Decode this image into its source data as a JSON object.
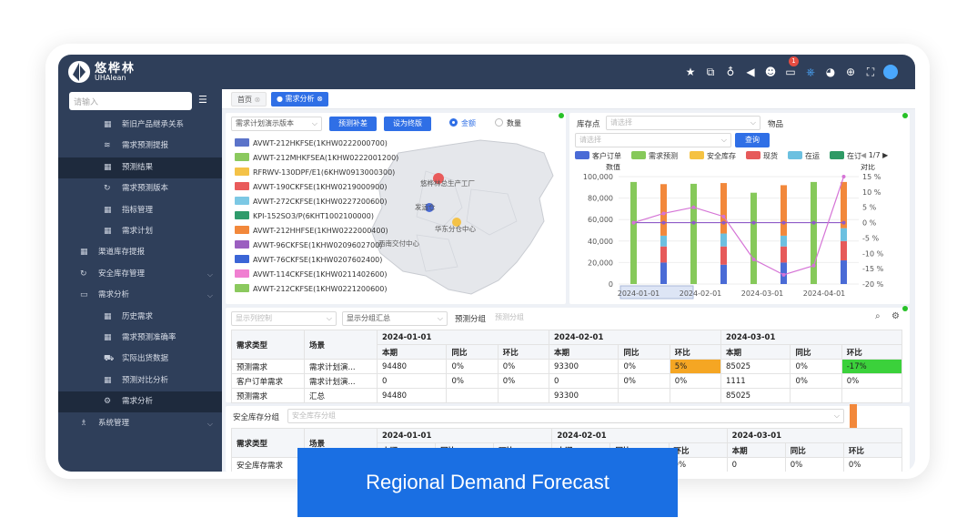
{
  "app": {
    "name_cn": "悠桦林",
    "name_en": "UHAlean",
    "notification_count": "1"
  },
  "topbar_icons": [
    "star-icon",
    "copy-icon",
    "user-settings-icon",
    "volume-icon",
    "face-icon",
    "message-icon",
    "robot-icon",
    "pie-icon",
    "globe-icon",
    "fullscreen-icon",
    "avatar"
  ],
  "sidebar": {
    "search_placeholder": "请输入",
    "items": [
      {
        "label": "新旧产品继承关系",
        "icon": "grid-icon",
        "level": 2
      },
      {
        "label": "需求预测提报",
        "icon": "layers-icon",
        "level": 2
      },
      {
        "label": "预测结果",
        "icon": "grid-icon",
        "level": 2,
        "active": true
      },
      {
        "label": "需求预测版本",
        "icon": "refresh-icon",
        "level": 2
      },
      {
        "label": "指标管理",
        "icon": "grid-icon",
        "level": 2
      },
      {
        "label": "需求计划",
        "icon": "grid-icon",
        "level": 2
      },
      {
        "label": "渠道库存提报",
        "icon": "grid-icon",
        "level": 1
      },
      {
        "label": "安全库存管理",
        "icon": "refresh-icon",
        "level": 1
      },
      {
        "label": "需求分析",
        "icon": "monitor-icon",
        "level": 1
      },
      {
        "label": "历史需求",
        "icon": "grid-icon",
        "level": 2
      },
      {
        "label": "需求预测准确率",
        "icon": "grid-icon",
        "level": 2
      },
      {
        "label": "实际出货数据",
        "icon": "truck-icon",
        "level": 2
      },
      {
        "label": "预测对比分析",
        "icon": "grid-icon",
        "level": 2
      },
      {
        "label": "需求分析",
        "icon": "gear-icon",
        "level": 2,
        "active": true
      },
      {
        "label": "系统管理",
        "icon": "users-icon",
        "level": 1
      }
    ]
  },
  "tabs": {
    "home": "首页",
    "active": "需求分析"
  },
  "toolbar": {
    "version_select": "需求计划演示版本",
    "btn_correct": "预测补差",
    "btn_baseline": "设为终版",
    "radio_amount": "金额",
    "radio_qty": "数量"
  },
  "map_legend": [
    {
      "label": "AVWT-212HKFSE(1KHW0222000700)",
      "color": "#5b73c9"
    },
    {
      "label": "AVWT-212MHKFSEA(1KHW0222001200)",
      "color": "#8bc95e"
    },
    {
      "label": "RFRWV-130DPF/E1(6KHW0913000300)",
      "color": "#f4c247"
    },
    {
      "label": "AVWT-190CKFSE(1KHW0219000900)",
      "color": "#e95b5b"
    },
    {
      "label": "AVWT-272CKFSE(1KHW0227200600)",
      "color": "#7cc8e4"
    },
    {
      "label": "KPI-152SO3/P(6KHT1002100000)",
      "color": "#2f9b6b"
    },
    {
      "label": "AVWT-212HHFSE(1KHW0222000400)",
      "color": "#f2883b"
    },
    {
      "label": "AVWT-96CKFSE(1KHW0209602700)",
      "color": "#9b5fc0"
    },
    {
      "label": "AVWT-76CKFSE(1KHW0207602400)",
      "color": "#3b65d6"
    },
    {
      "label": "AVWT-114CKFSE(1KHW0211402600)",
      "color": "#f07fd1"
    },
    {
      "label": "AVWT-212CKFSE(1KHW0221200600)",
      "color": "#8bc95e"
    }
  ],
  "map_labels": [
    "悠桦林总生产工厂",
    "发运仓",
    "华东分仓中心",
    "西南交付中心"
  ],
  "chart_filters": {
    "loc_label": "库存点",
    "loc_placeholder": "请选择",
    "item_label": "物品",
    "item_placeholder": "请选择",
    "query_button": "查询"
  },
  "chart_legend": [
    {
      "label": "客户订单",
      "color": "#4a6bd6"
    },
    {
      "label": "需求预测",
      "color": "#86c95a"
    },
    {
      "label": "安全库存",
      "color": "#f5c242"
    },
    {
      "label": "现货",
      "color": "#e65a5a"
    },
    {
      "label": "在运",
      "color": "#6cc0e0"
    },
    {
      "label": "在订",
      "color": "#2e9a65"
    }
  ],
  "legend_pager": "1/7",
  "chart_data": {
    "type": "bar",
    "y_left_label": "数值",
    "y_right_label": "对比",
    "y_left_ticks": [
      "100,000",
      "80,000",
      "60,000",
      "40,000",
      "20,000",
      "0"
    ],
    "y_right_ticks": [
      "15 %",
      "10 %",
      "5 %",
      "0 %",
      "-5 %",
      "-10 %",
      "-15 %",
      "-20 %"
    ],
    "x_ticks": [
      "2024-01-01",
      "2024-02-01",
      "2024-03-01",
      "2024-04-01"
    ],
    "ylim": [
      0,
      100000
    ],
    "y2lim": [
      -20,
      15
    ],
    "series_colors": [
      "#4a6bd6",
      "#86c95a",
      "#f5c242",
      "#e65a5a",
      "#6cc0e0",
      "#f2883b"
    ],
    "bars": [
      {
        "x": "2024-01-01",
        "series": "需求预测",
        "stack": [
          0,
          95000,
          0,
          0,
          0,
          0
        ]
      },
      {
        "x": "2024-01-01",
        "series": "stack",
        "stack": [
          20000,
          0,
          0,
          15000,
          10000,
          48000
        ]
      },
      {
        "x": "2024-02-01",
        "series": "需求预测",
        "stack": [
          0,
          93300,
          0,
          0,
          0,
          0
        ]
      },
      {
        "x": "2024-02-01",
        "series": "stack",
        "stack": [
          18000,
          0,
          0,
          17000,
          12000,
          47000
        ]
      },
      {
        "x": "2024-03-01",
        "series": "需求预测",
        "stack": [
          0,
          85000,
          0,
          0,
          0,
          0
        ]
      },
      {
        "x": "2024-03-01",
        "series": "stack",
        "stack": [
          20000,
          0,
          0,
          15000,
          10000,
          47000
        ]
      },
      {
        "x": "2024-04-01",
        "series": "需求预测",
        "stack": [
          0,
          95000,
          0,
          0,
          0,
          0
        ]
      },
      {
        "x": "2024-04-01",
        "series": "stack",
        "stack": [
          22000,
          0,
          0,
          18000,
          12000,
          43000
        ]
      }
    ],
    "bar_dates": [
      "2024-01-01",
      "2024-01-15",
      "2024-02-01",
      "2024-02-15",
      "2024-03-01",
      "2024-03-15",
      "2024-04-01",
      "2024-04-10"
    ],
    "line_purple": [
      0,
      0,
      0,
      0,
      0,
      0,
      0,
      0
    ],
    "line_pink": [
      0,
      3,
      5,
      2,
      -12,
      -17,
      -14,
      15
    ]
  },
  "table_filters": {
    "display_columns": "显示列控制",
    "display_summary": "显示分组汇总",
    "group_label": "预测分组",
    "group_placeholder": "预测分组"
  },
  "table1": {
    "col_type": "需求类型",
    "col_scene": "场景",
    "periods": [
      "2024-01-01",
      "2024-02-01",
      "2024-03-01"
    ],
    "sub_cols": [
      "本期",
      "同比",
      "环比"
    ],
    "rows": [
      {
        "type": "预测需求",
        "scene": "需求计划演...",
        "vals": [
          "94480",
          "0%",
          "0%",
          "93300",
          "0%",
          "5%",
          "85025",
          "0%",
          "-17%"
        ]
      },
      {
        "type": "客户订单需求",
        "scene": "需求计划演...",
        "vals": [
          "0",
          "0%",
          "0%",
          "0",
          "0%",
          "0%",
          "1111",
          "0%",
          "0%"
        ]
      },
      {
        "type": "预测需求",
        "scene": "汇总",
        "vals": [
          "94480",
          "",
          "",
          "93300",
          "",
          "",
          "85025",
          "",
          ""
        ]
      }
    ]
  },
  "table2": {
    "group_label": "安全库存分组",
    "group_placeholder": "安全库存分组",
    "col_type": "需求类型",
    "col_scene": "场景",
    "periods": [
      "2024-01-01",
      "2024-02-01",
      "2024-03-01"
    ],
    "sub_cols": [
      "本期",
      "同比",
      "环比"
    ],
    "row": {
      "type": "安全库存需求",
      "vals_visible": [
        "0%",
        "0",
        "0%",
        "0%"
      ]
    }
  },
  "banner": "Regional Demand Forecast"
}
